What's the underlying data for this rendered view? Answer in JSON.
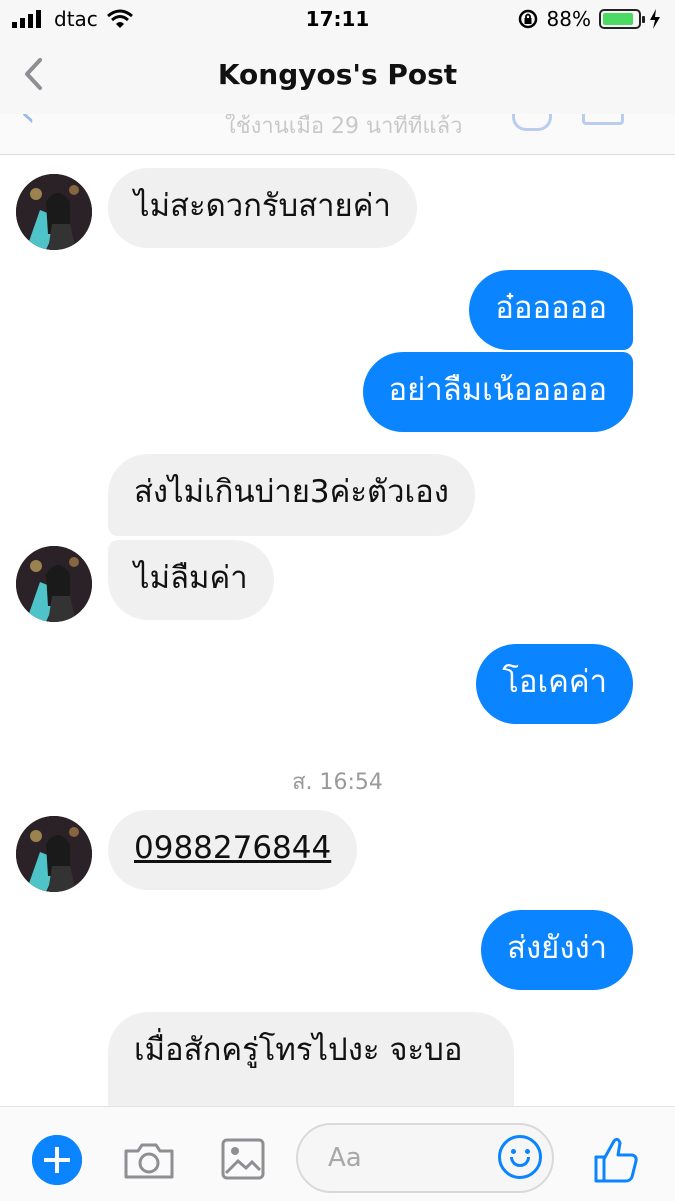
{
  "status_bar": {
    "carrier": "dtac",
    "time": "17:11",
    "battery_percent": "88%",
    "battery_level": 0.88
  },
  "nav": {
    "back_icon": "chevron-left-icon",
    "title": "Kongyos's Post"
  },
  "subheader": {
    "active_text": "ใช้งานเมื่อ 29 นาทีที่แล้ว"
  },
  "messages": [
    {
      "side": "in",
      "text": "ไม่สะดวกรับสายค่า"
    },
    {
      "side": "out",
      "text": "อ๋อออออ"
    },
    {
      "side": "out",
      "text": "อย่าลืมเน้อออออ"
    },
    {
      "side": "in",
      "text": "ส่งไม่เกินบ่าย3ค่ะตัวเอง"
    },
    {
      "side": "in",
      "text": "ไม่ลืมค่า"
    },
    {
      "side": "out",
      "text": "โอเคค่า"
    },
    {
      "side": "in",
      "text": "0988276844"
    },
    {
      "side": "out",
      "text": "ส่งยังง่า"
    },
    {
      "side": "in",
      "text": "เมื่อสักครู่โทรไปงะ จะบอ"
    }
  ],
  "timestamp": "ส. 16:54",
  "composer": {
    "placeholder": "Aa"
  },
  "colors": {
    "accent": "#0a84ff",
    "incoming_bubble": "#f0f0f0",
    "battery": "#4cd964"
  }
}
